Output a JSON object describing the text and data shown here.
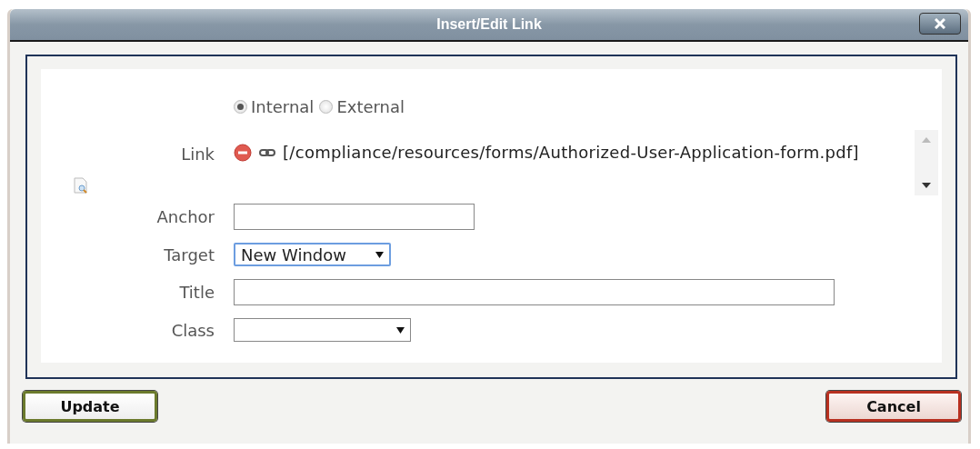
{
  "window": {
    "title": "Insert/Edit Link"
  },
  "link_type": [
    {
      "label": "Internal",
      "selected": true
    },
    {
      "label": "External",
      "selected": false
    }
  ],
  "link": {
    "label": "Link",
    "value": "[/compliance/resources/forms/Authorized-User-Application-form.pdf]"
  },
  "fields": [
    {
      "kind": "text",
      "label": "Anchor"
    },
    {
      "kind": "select",
      "label": "Target",
      "value": "New Window",
      "focused": true
    },
    {
      "kind": "text",
      "label": "Title"
    },
    {
      "kind": "select",
      "label": "Class",
      "focused": false
    }
  ],
  "buttons": [
    {
      "label": "Update",
      "kind": "primary"
    },
    {
      "label": "Cancel",
      "kind": "cancel"
    }
  ]
}
